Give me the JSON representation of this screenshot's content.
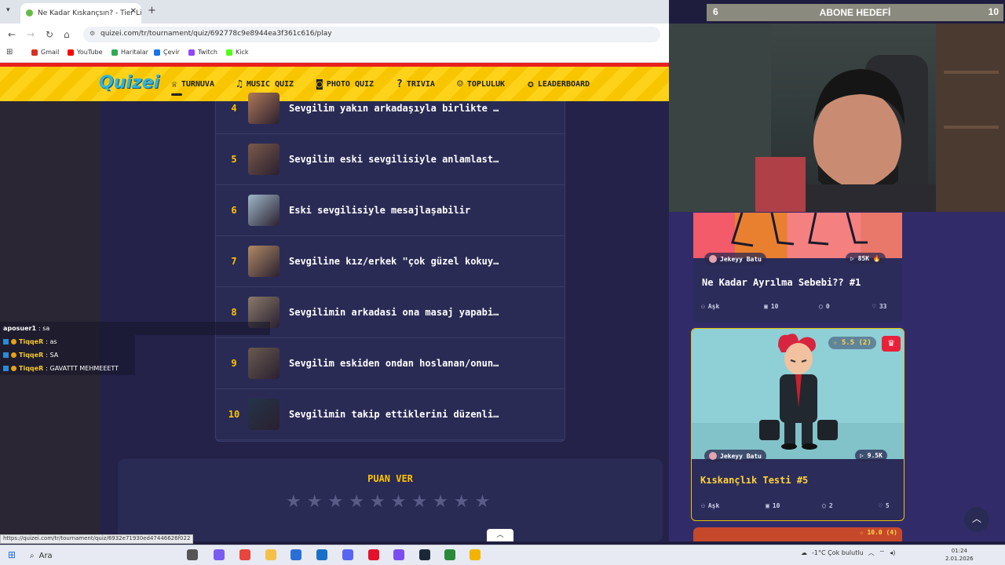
{
  "browser": {
    "tab_title": "Ne Kadar Kıskançsın? - Tier List",
    "url": "quizei.com/tr/tournament/quiz/692778c9e8944ea3f361c616/play",
    "bookmarks": [
      "Gmail",
      "YouTube",
      "Haritalar",
      "Çevir",
      "Twitch",
      "Kick"
    ],
    "bookmark_colors": [
      "#d93025",
      "#ff0000",
      "#34a853",
      "#1a73e8",
      "#9146ff",
      "#53fc18"
    ],
    "status_url": "https://quizei.com/tr/tournament/quiz/6932e71930ed47446626f022"
  },
  "site_nav": {
    "logo": "Quizei",
    "items": [
      "TURNUVA",
      "MUSIC QUIZ",
      "PHOTO QUIZ",
      "TRIVIA",
      "TOPLULUK",
      "LEADERBOARD"
    ],
    "icons": [
      "trophy-icon",
      "music-note-icon",
      "camera-icon",
      "question-bubble-icon",
      "people-icon",
      "award-icon"
    ]
  },
  "ranking": {
    "rows": [
      {
        "rank": "4",
        "text": "Sevgilim yakın arkadaşıyla birlikte …",
        "thumb": "#b07856"
      },
      {
        "rank": "5",
        "text": "Sevgilim eski sevgilisiyle anlamlast…",
        "thumb": "#7a5a4a"
      },
      {
        "rank": "6",
        "text": "Eski sevgilisiyle mesajlaşabilir",
        "thumb": "#9fb8c8"
      },
      {
        "rank": "7",
        "text": "Sevgiline kız/erkek \"çok güzel kokuy…",
        "thumb": "#b08a64"
      },
      {
        "rank": "8",
        "text": "Sevgilimin arkadasi ona masaj yapabi…",
        "thumb": "#8a7a6a"
      },
      {
        "rank": "9",
        "text": "Sevgilim eskiden ondan hoslanan/onun…",
        "thumb": "#6a5a50"
      },
      {
        "rank": "10",
        "text": "Sevgilimin takip ettiklerini düzenli…",
        "thumb": "#243448"
      }
    ]
  },
  "rating": {
    "title": "PUAN VER",
    "stars": [
      "★",
      "★",
      "★",
      "★",
      "★",
      "★",
      "★",
      "★",
      "★",
      "★"
    ]
  },
  "chat": [
    {
      "user": "aposuer1",
      "msg": ": sa",
      "badges": 0
    },
    {
      "user": "TiqqeR",
      "msg": ": as",
      "badges": 2
    },
    {
      "user": "TiqqeR",
      "msg": ": SA",
      "badges": 2
    },
    {
      "user": "TiqqeR",
      "msg": ": GAVATTT MEHMEEETT",
      "badges": 2
    }
  ],
  "cards": {
    "card1": {
      "author": "Jekeyy Batu",
      "views": "85K",
      "title": "Ne Kadar Ayrılma Sebebi?? #1",
      "category": "Aşk",
      "questions": "10",
      "comments": "0",
      "likes": "33"
    },
    "card2": {
      "author": "Jekeyy Batu",
      "views": "9.5K",
      "rating": "5.5 (2)",
      "title": "Kıskançlık Testi #5",
      "category": "Aşk",
      "questions": "10",
      "comments": "2",
      "likes": "5"
    },
    "card3": {
      "rating": "10.0 (4)"
    }
  },
  "stream_overlay": {
    "left_count": "6",
    "title": "ABONE HEDEFİ",
    "right_count": "10"
  },
  "taskbar": {
    "search_placeholder": "Ara",
    "weather": "-1°C Çok bulutlu",
    "time": "01:24",
    "date": "2.01.2026"
  }
}
